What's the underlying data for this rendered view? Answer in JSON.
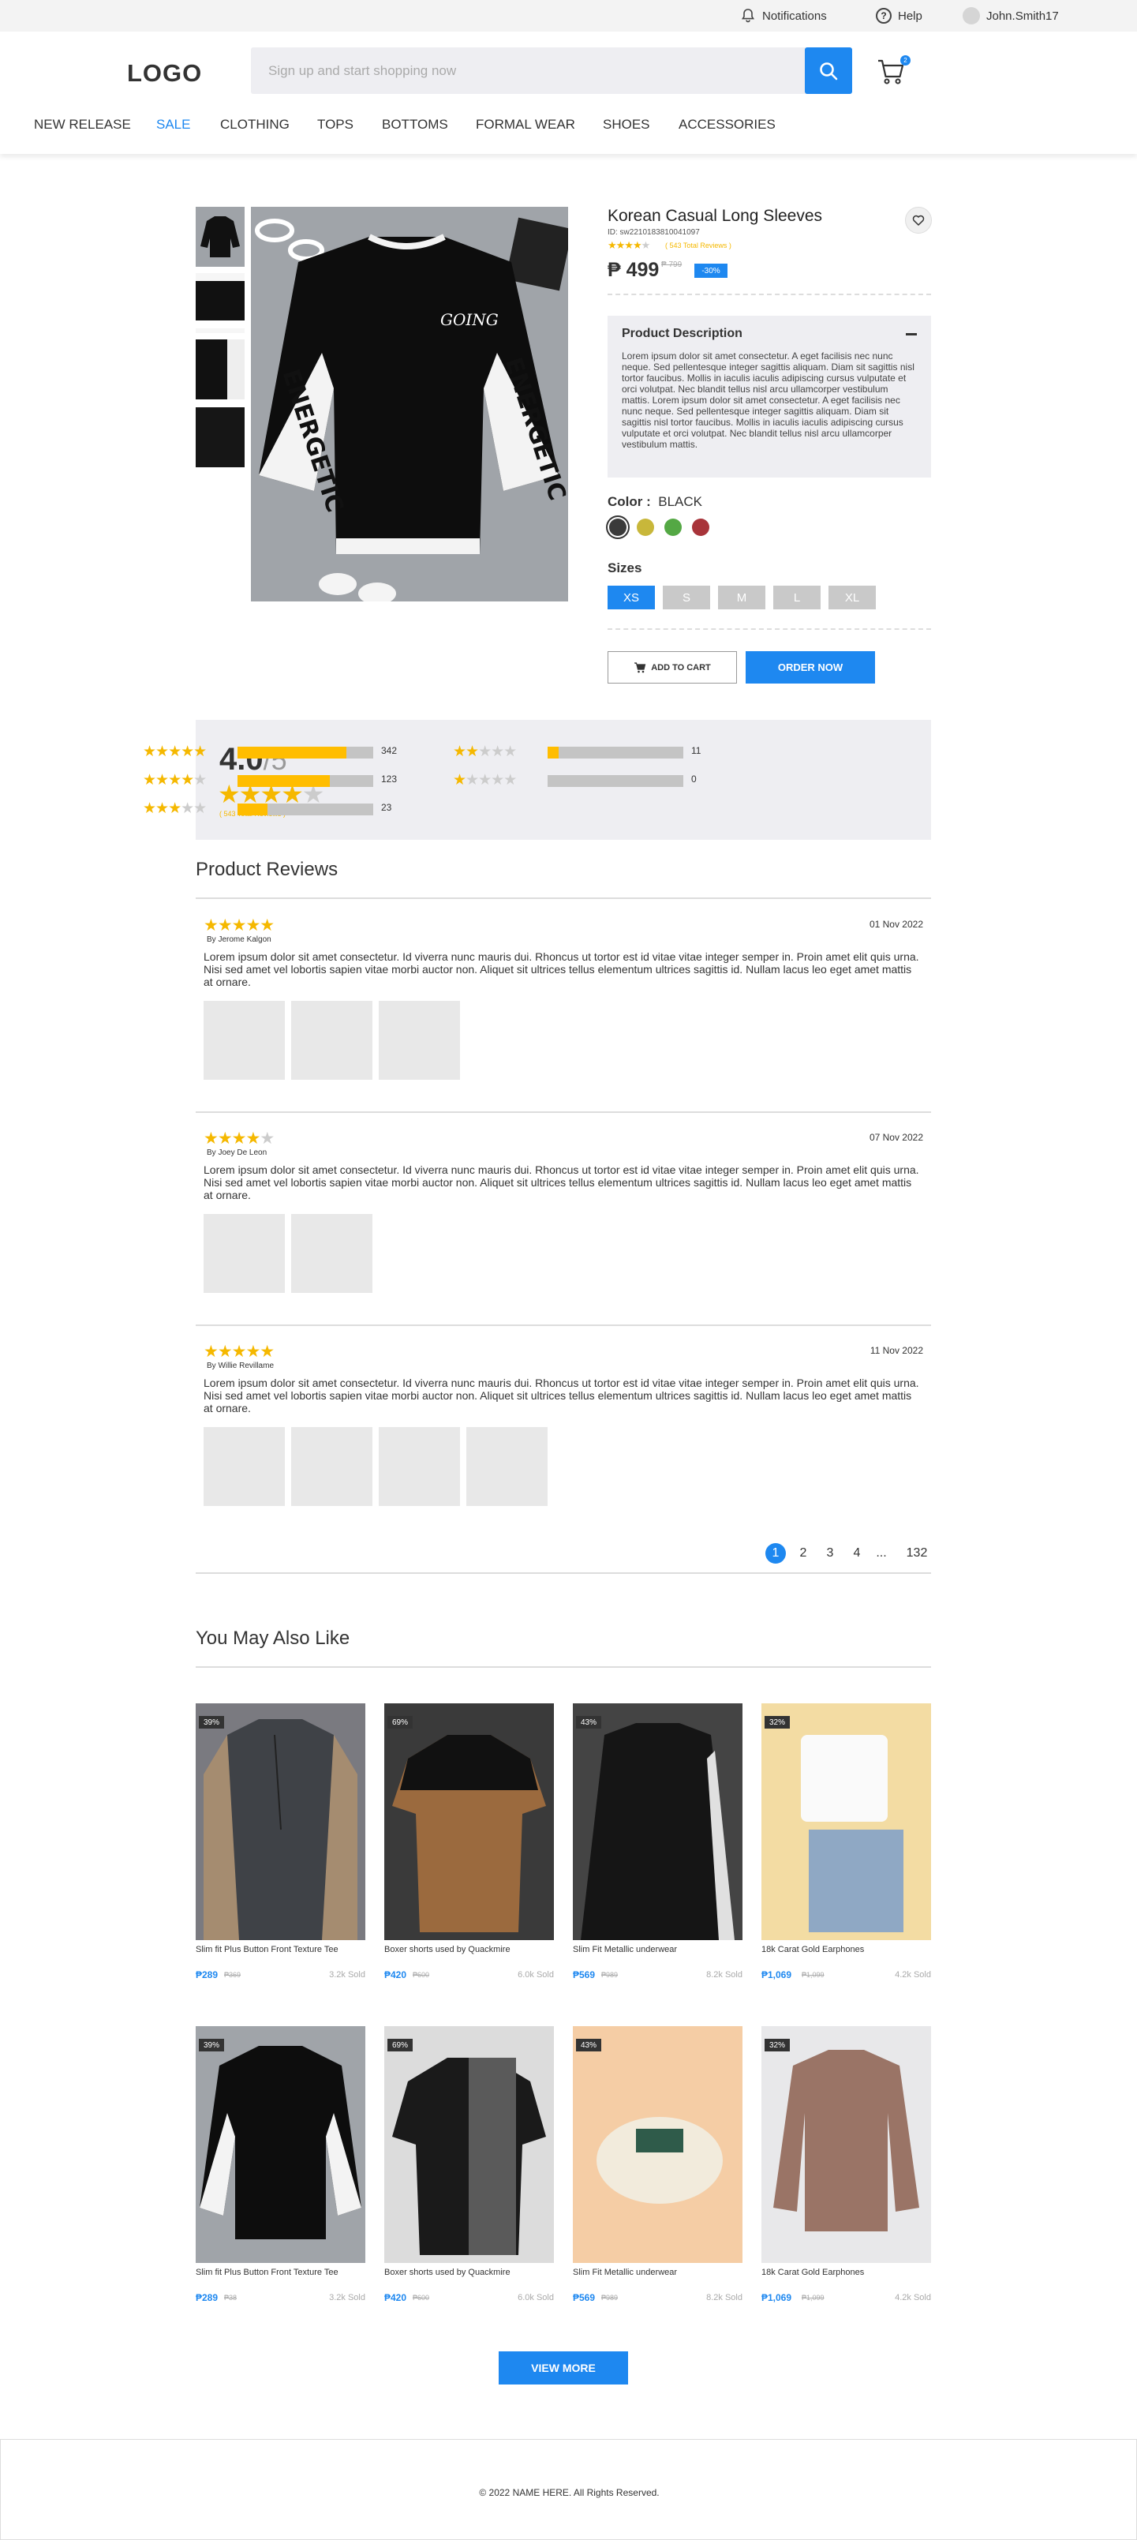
{
  "topbar": {
    "notifications": "Notifications",
    "help": "Help",
    "username": "John.Smith17"
  },
  "header": {
    "logo": "LOGO",
    "search_placeholder": "Sign up and start shopping now",
    "cart_count": "2"
  },
  "nav": [
    "NEW RELEASE",
    "SALE",
    "CLOTHING",
    "TOPS",
    "BOTTOMS",
    "FORMAL WEAR",
    "SHOES",
    "ACCESSORIES"
  ],
  "nav_active": "SALE",
  "product": {
    "title": "Korean Casual Long Sleeves",
    "id": "ID: sw2210183810041097",
    "rating_link": "( 543 Total Reviews )",
    "price": "₱ 499",
    "old_price": "₱ 799",
    "discount": "-30%",
    "description_heading": "Product Description",
    "description": "Lorem ipsum dolor sit amet consectetur. A eget facilisis nec nunc neque. Sed pellentesque integer sagittis aliquam. Diam sit sagittis nisl tortor faucibus. Mollis in iaculis iaculis adipiscing cursus vulputate et orci volutpat. Nec blandit tellus nisl arcu ullamcorper vestibulum mattis. Lorem ipsum dolor sit amet consectetur. A eget facilisis nec nunc neque. Sed pellentesque integer sagittis aliquam. Diam sit sagittis nisl tortor faucibus. Mollis in iaculis iaculis adipiscing cursus vulputate et orci volutpat. Nec blandit tellus nisl arcu ullamcorper vestibulum mattis.",
    "color_label": "Color :",
    "color_value": "BLACK",
    "colors": [
      "#3a3a3a",
      "#c8b73a",
      "#54a844",
      "#a8343a"
    ],
    "sizes_label": "Sizes",
    "sizes": [
      "XS",
      "S",
      "M",
      "L",
      "XL"
    ],
    "add_to_cart": "ADD TO CART",
    "order_now": "ORDER NOW",
    "print_text": "GOING",
    "sleeve_text": "ENERGETIC"
  },
  "rating_summary": {
    "average": "4.0",
    "out_of": "/5",
    "total": "( 543 Total Reviews )",
    "rows": [
      {
        "stars": 5,
        "count": "342",
        "fraction": 0.8
      },
      {
        "stars": 4,
        "count": "123",
        "fraction": 0.68
      },
      {
        "stars": 3,
        "count": "23",
        "fraction": 0.22
      },
      {
        "stars": 2,
        "count": "11",
        "fraction": 0.08
      },
      {
        "stars": 1,
        "count": "0",
        "fraction": 0.0
      }
    ]
  },
  "reviews_title": "Product Reviews",
  "reviews": [
    {
      "stars": 5,
      "date": "01 Nov 2022",
      "by": "By Jerome Kalgon",
      "text": "Lorem ipsum dolor sit amet consectetur. Id viverra nunc mauris dui. Rhoncus ut tortor est id vitae vitae integer semper in. Proin amet elit quis urna. Nisi sed amet vel lobortis sapien vitae morbi auctor non. Aliquet sit ultrices tellus elementum ultrices sagittis id. Nullam lacus leo eget amet mattis at ornare.",
      "photos": 3
    },
    {
      "stars": 4,
      "date": "07 Nov 2022",
      "by": "By Joey De Leon",
      "text": "Lorem ipsum dolor sit amet consectetur. Id viverra nunc mauris dui. Rhoncus ut tortor est id vitae vitae integer semper in. Proin amet elit quis urna. Nisi sed amet vel lobortis sapien vitae morbi auctor non. Aliquet sit ultrices tellus elementum ultrices sagittis id. Nullam lacus leo eget amet mattis at ornare.",
      "photos": 2
    },
    {
      "stars": 5,
      "date": "11 Nov 2022",
      "by": "By Willie Revillame",
      "text": "Lorem ipsum dolor sit amet consectetur. Id viverra nunc mauris dui. Rhoncus ut tortor est id vitae vitae integer semper in. Proin amet elit quis urna. Nisi sed amet vel lobortis sapien vitae morbi auctor non. Aliquet sit ultrices tellus elementum ultrices sagittis id. Nullam lacus leo eget amet mattis at ornare.",
      "photos": 4
    }
  ],
  "pagination": [
    "1",
    "2",
    "3",
    "4",
    "...",
    "132"
  ],
  "also_like_title": "You May Also Like",
  "products": [
    {
      "badge": "39%",
      "name": "Slim fit Plus Button Front Texture Tee",
      "price": "₱289",
      "old": "₱369",
      "sold": "3.2k Sold",
      "bg": "#7a7a80"
    },
    {
      "badge": "69%",
      "name": "Boxer shorts used by Quackmire",
      "price": "₱420",
      "old": "₱600",
      "sold": "6.0k Sold",
      "bg": "#c9c9c9"
    },
    {
      "badge": "43%",
      "name": "Slim Fit Metallic underwear",
      "price": "₱569",
      "old": "₱989",
      "sold": "8.2k Sold",
      "bg": "#5a5a5a"
    },
    {
      "badge": "32%",
      "name": "18k Carat Gold Earphones",
      "price": "₱1,069",
      "old": "₱1,099",
      "sold": "4.2k Sold",
      "bg": "#f5dfa8"
    },
    {
      "badge": "39%",
      "name": "Slim fit Plus Button Front Texture Tee",
      "price": "₱289",
      "old": "₱38",
      "sold": "3.2k Sold",
      "bg": "#9fa3a8"
    },
    {
      "badge": "69%",
      "name": "Boxer shorts used by Quackmire",
      "price": "₱420",
      "old": "₱600",
      "sold": "6.0k Sold",
      "bg": "#d8d8d8"
    },
    {
      "badge": "43%",
      "name": "Slim Fit Metallic underwear",
      "price": "₱569",
      "old": "₱989",
      "sold": "8.2k Sold",
      "bg": "#f4c9a0"
    },
    {
      "badge": "32%",
      "name": "18k Carat Gold Earphones",
      "price": "₱1,069",
      "old": "₱1,099",
      "sold": "4.2k Sold",
      "bg": "#e6e6e6"
    }
  ],
  "view_more": "VIEW MORE",
  "footer": "© 2022 NAME HERE. All Rights Reserved."
}
